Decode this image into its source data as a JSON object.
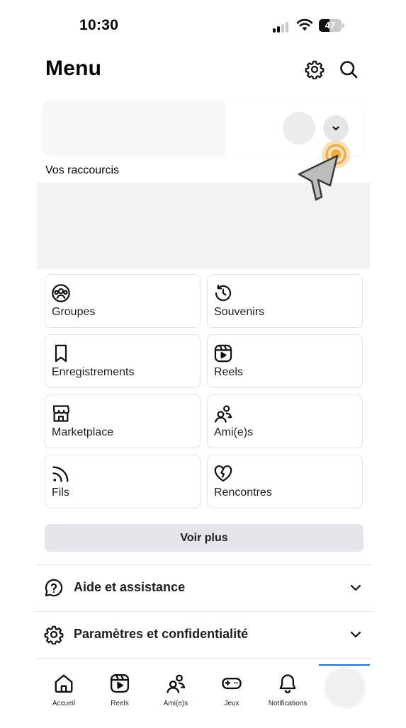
{
  "status_bar": {
    "time": "10:30",
    "battery_level": "47",
    "battery_fraction": 0.47
  },
  "header": {
    "title": "Menu",
    "settings_icon": "gear-icon",
    "search_icon": "search-icon"
  },
  "profile": {
    "expand_icon": "chevron-down-icon"
  },
  "shortcuts": {
    "title": "Vos raccourcis"
  },
  "tiles": [
    {
      "label": "Groupes",
      "icon": "groups-icon"
    },
    {
      "label": "Souvenirs",
      "icon": "memories-icon"
    },
    {
      "label": "Enregistrements",
      "icon": "bookmark-icon"
    },
    {
      "label": "Reels",
      "icon": "reels-icon"
    },
    {
      "label": "Marketplace",
      "icon": "marketplace-icon"
    },
    {
      "label": "Ami(e)s",
      "icon": "friends-icon"
    },
    {
      "label": "Fils",
      "icon": "feeds-icon"
    },
    {
      "label": "Rencontres",
      "icon": "dating-icon"
    }
  ],
  "see_more_label": "Voir plus",
  "sections": [
    {
      "label": "Aide et assistance",
      "icon": "help-icon"
    },
    {
      "label": "Paramètres et confidentialité",
      "icon": "gear-icon"
    }
  ],
  "tabbar": {
    "items": [
      {
        "label": "Accueil",
        "icon": "home-icon"
      },
      {
        "label": "Reels",
        "icon": "reels-icon"
      },
      {
        "label": "Ami(e)s",
        "icon": "friends-icon"
      },
      {
        "label": "Jeux",
        "icon": "gamepad-icon"
      },
      {
        "label": "Notifications",
        "icon": "bell-icon"
      }
    ],
    "active_index": 5
  },
  "colors": {
    "accent": "#1b74e4",
    "text": "#1c1e21",
    "tap_highlight": "#f2a93b"
  }
}
